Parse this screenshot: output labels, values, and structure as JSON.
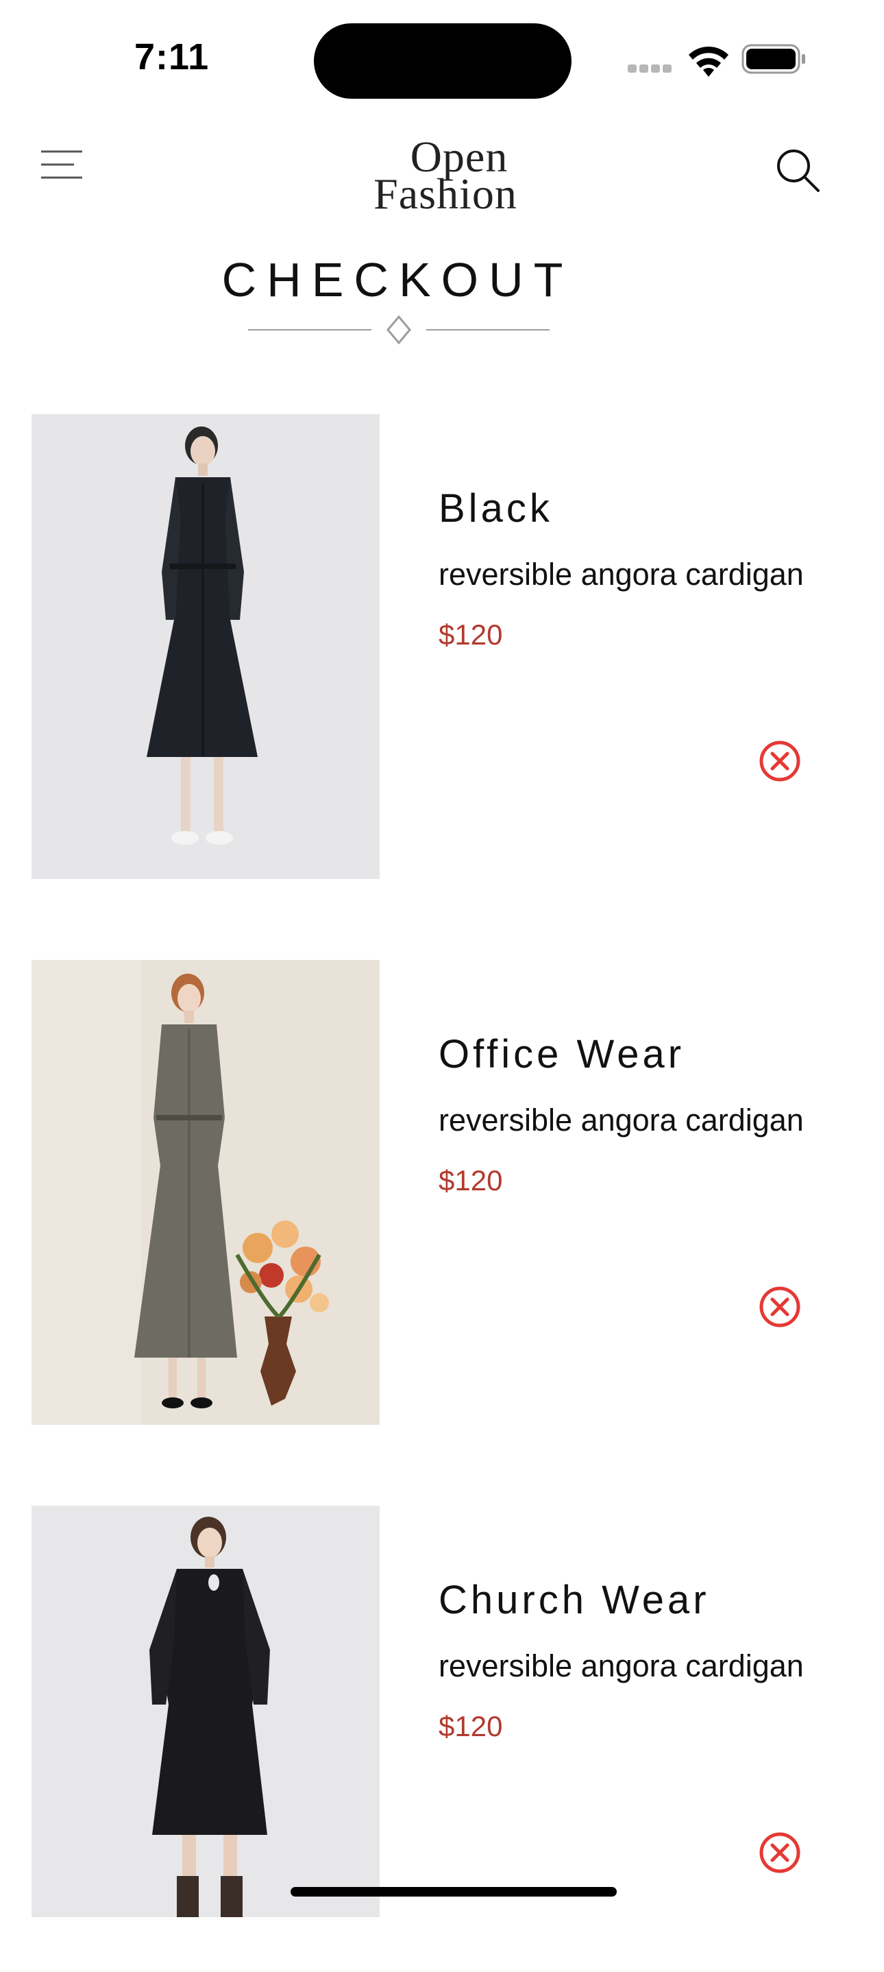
{
  "status_bar": {
    "time": "7:11"
  },
  "header": {
    "logo_line1": "Open",
    "logo_line2": "Fashion",
    "menu_icon": "hamburger-menu-icon",
    "search_icon": "search-icon"
  },
  "page": {
    "title": "CHECKOUT"
  },
  "cart_items": [
    {
      "name": "Black",
      "description": "reversible angora cardigan",
      "price": "$120"
    },
    {
      "name": "Office Wear",
      "description": "reversible angora cardigan",
      "price": "$120"
    },
    {
      "name": "Church Wear",
      "description": "reversible angora cardigan",
      "price": "$120"
    }
  ],
  "colors": {
    "price": "#b23a2e",
    "remove_icon": "#e53935",
    "divider": "#9e9e9e"
  }
}
